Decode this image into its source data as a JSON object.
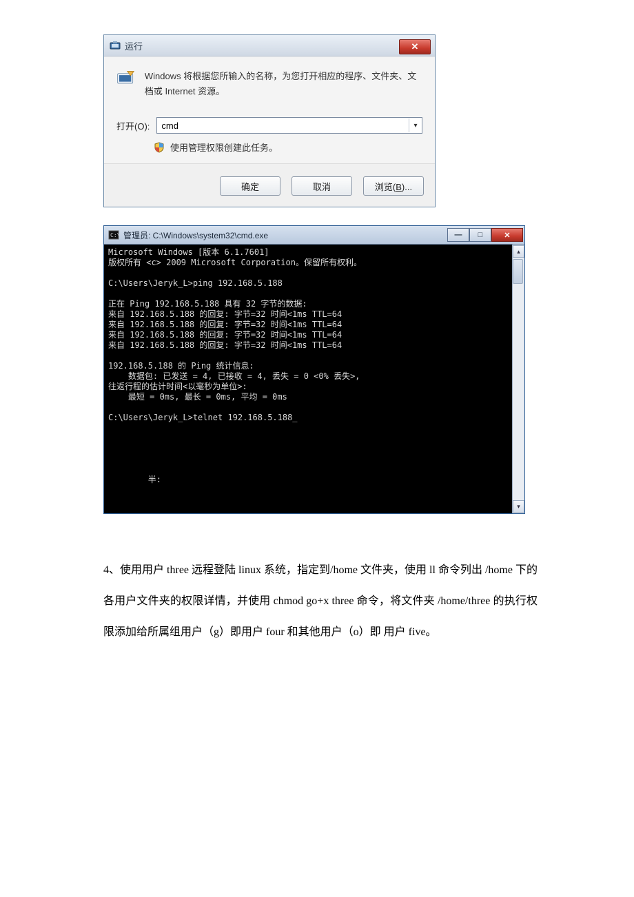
{
  "run": {
    "title": "运行",
    "close_glyph": "✕",
    "description": "Windows 将根据您所输入的名称，为您打开相应的程序、文件夹、文档或 Internet 资源。",
    "open_label": "打开(O):",
    "input_value": "cmd",
    "dropdown_glyph": "▾",
    "admin_note": "使用管理权限创建此任务。",
    "ok_label": "确定",
    "cancel_label": "取消",
    "browse_label_prefix": "浏览(",
    "browse_label_underline": "B",
    "browse_label_suffix": ")..."
  },
  "cmd": {
    "title": "管理员: C:\\Windows\\system32\\cmd.exe",
    "minimize_glyph": "—",
    "maximize_glyph": "□",
    "close_glyph": "✕",
    "scroll_up": "▴",
    "scroll_down": "▾",
    "content": "Microsoft Windows [版本 6.1.7601]\n版权所有 <c> 2009 Microsoft Corporation。保留所有权利。\n\nC:\\Users\\Jeryk_L>ping 192.168.5.188\n\n正在 Ping 192.168.5.188 具有 32 字节的数据:\n来自 192.168.5.188 的回复: 字节=32 时间<1ms TTL=64\n来自 192.168.5.188 的回复: 字节=32 时间<1ms TTL=64\n来自 192.168.5.188 的回复: 字节=32 时间<1ms TTL=64\n来自 192.168.5.188 的回复: 字节=32 时间<1ms TTL=64\n\n192.168.5.188 的 Ping 统计信息:\n    数据包: 已发送 = 4, 已接收 = 4, 丢失 = 0 <0% 丢失>,\n往返行程的估计时间<以毫秒为单位>:\n    最短 = 0ms, 最长 = 0ms, 平均 = 0ms\n\nC:\\Users\\Jeryk_L>telnet 192.168.5.188_\n\n\n\n\n\n        半:"
  },
  "paragraph": {
    "s1": "4、使用用户 three 远程登陆 linux 系统，指定到/home 文件夹，使用 ll 命令列出",
    "s2": "/home 下的各用户文件夹的权限详情，并使用 chmod go+x three 命令，将文件夹",
    "s3": "/home/three 的执行权限添加给所属组用户（g）即用户 four 和其他用户（o）即",
    "s4": "用户 five。"
  }
}
